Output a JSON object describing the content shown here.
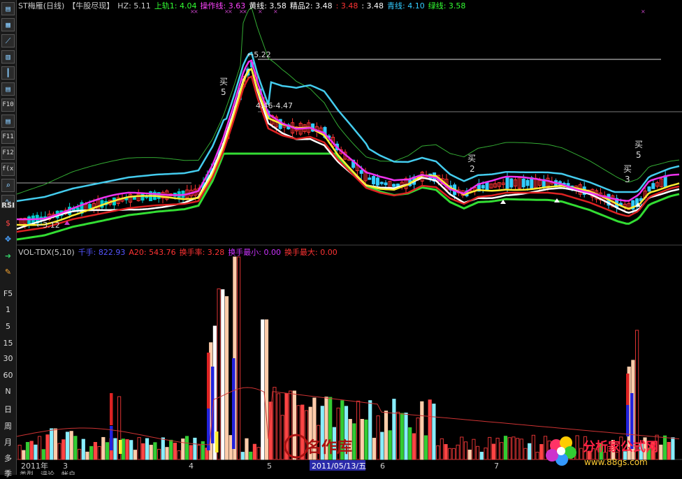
{
  "title_bar": {
    "stock": "ST梅雁(日线)",
    "indicator": "【牛股尽现】",
    "items": [
      {
        "label": "HZ:",
        "value": "5.11",
        "color": "#cccccc"
      },
      {
        "label": "上轨1:",
        "value": "4.04",
        "color": "#33ff33"
      },
      {
        "label": "操作线:",
        "value": "3.63",
        "color": "#ff44ff"
      },
      {
        "label": "黄线:",
        "value": "3.58",
        "color": "#ffffff"
      },
      {
        "label": "精品2:",
        "value": "3.48",
        "color": "#ffffff"
      },
      {
        "label": ":",
        "value": "3.48",
        "color": "#ff3333"
      },
      {
        "label": ":",
        "value": "3.48",
        "color": "#ffffff"
      },
      {
        "label": "青线:",
        "value": "4.10",
        "color": "#33ccff"
      },
      {
        "label": "绿线:",
        "value": "3.58",
        "color": "#33ff33"
      }
    ]
  },
  "toolbar": {
    "buttons": [
      {
        "name": "kline-icon",
        "glyph": "▤"
      },
      {
        "name": "table-icon",
        "glyph": "▦"
      },
      {
        "name": "trend-icon",
        "glyph": "⟋"
      },
      {
        "name": "bar-chart-icon",
        "glyph": "▥"
      },
      {
        "name": "candle-icon",
        "glyph": "┃"
      },
      {
        "name": "list-icon",
        "glyph": "▤"
      },
      {
        "name": "f10-button",
        "glyph": "F10"
      },
      {
        "name": "detail-icon",
        "glyph": "▤"
      },
      {
        "name": "f11-button",
        "glyph": "F11"
      },
      {
        "name": "f12-button",
        "glyph": "F12"
      },
      {
        "name": "formula-button",
        "glyph": "f(x)"
      },
      {
        "name": "zoom-icon",
        "glyph": "⌕"
      },
      {
        "name": "indicator-icon",
        "glyph": "∿"
      }
    ],
    "labels": [
      "RSI",
      "$",
      "✥",
      "➜",
      "✎",
      "F5",
      "1",
      "5",
      "15",
      "30",
      "60",
      "N",
      "日",
      "周",
      "月",
      "多",
      "季"
    ]
  },
  "price_annotations": {
    "high": "5.22",
    "low": "3.12",
    "range": "4.46-4.47",
    "buy_labels": [
      "买",
      "5",
      "买",
      "2",
      "买",
      "5",
      "买",
      "3"
    ]
  },
  "volume_legend": {
    "name": "VOL-TDX(5,10)",
    "items": [
      {
        "label": "千手:",
        "value": "822.93",
        "color": "#5555ff"
      },
      {
        "label": "A20:",
        "value": "543.76",
        "color": "#ff3333"
      },
      {
        "label": "换手率:",
        "value": "3.28",
        "color": "#ff3333"
      },
      {
        "label": "换手最小:",
        "value": "0.00",
        "color": "#cc33ff"
      },
      {
        "label": "换手最大:",
        "value": "0.00",
        "color": "#ff3333"
      }
    ]
  },
  "x_axis": {
    "labels": [
      "2011年",
      "3",
      "4",
      "5",
      "6",
      "7"
    ],
    "cursor_date": "2011/05/13/五"
  },
  "watermark": {
    "brand": "分析家公式网",
    "url": "www.88gs.com",
    "center": "名作库"
  },
  "bottom_partial": [
    "类型",
    "评论",
    "帐户"
  ]
}
